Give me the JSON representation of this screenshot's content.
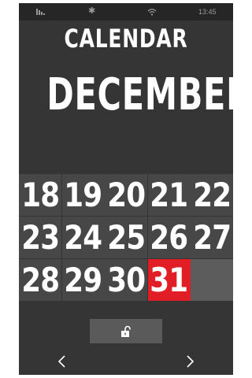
{
  "status_bar": {
    "time": "13:45",
    "icons": [
      "signal-icon",
      "bluetooth-icon",
      "wifi-icon"
    ]
  },
  "header": {
    "title": "CALENDAR",
    "month": "DECEMBER"
  },
  "calendar": {
    "days": [
      "18",
      "19",
      "20",
      "21",
      "22",
      "23",
      "24",
      "25",
      "26",
      "27",
      "28",
      "29",
      "30",
      "31",
      ""
    ],
    "highlighted_day": "31",
    "highlight_color": "#e11e25"
  },
  "controls": {
    "unlock_icon": "unlock-icon",
    "prev_icon": "chevron-left-icon",
    "next_icon": "chevron-right-icon"
  }
}
